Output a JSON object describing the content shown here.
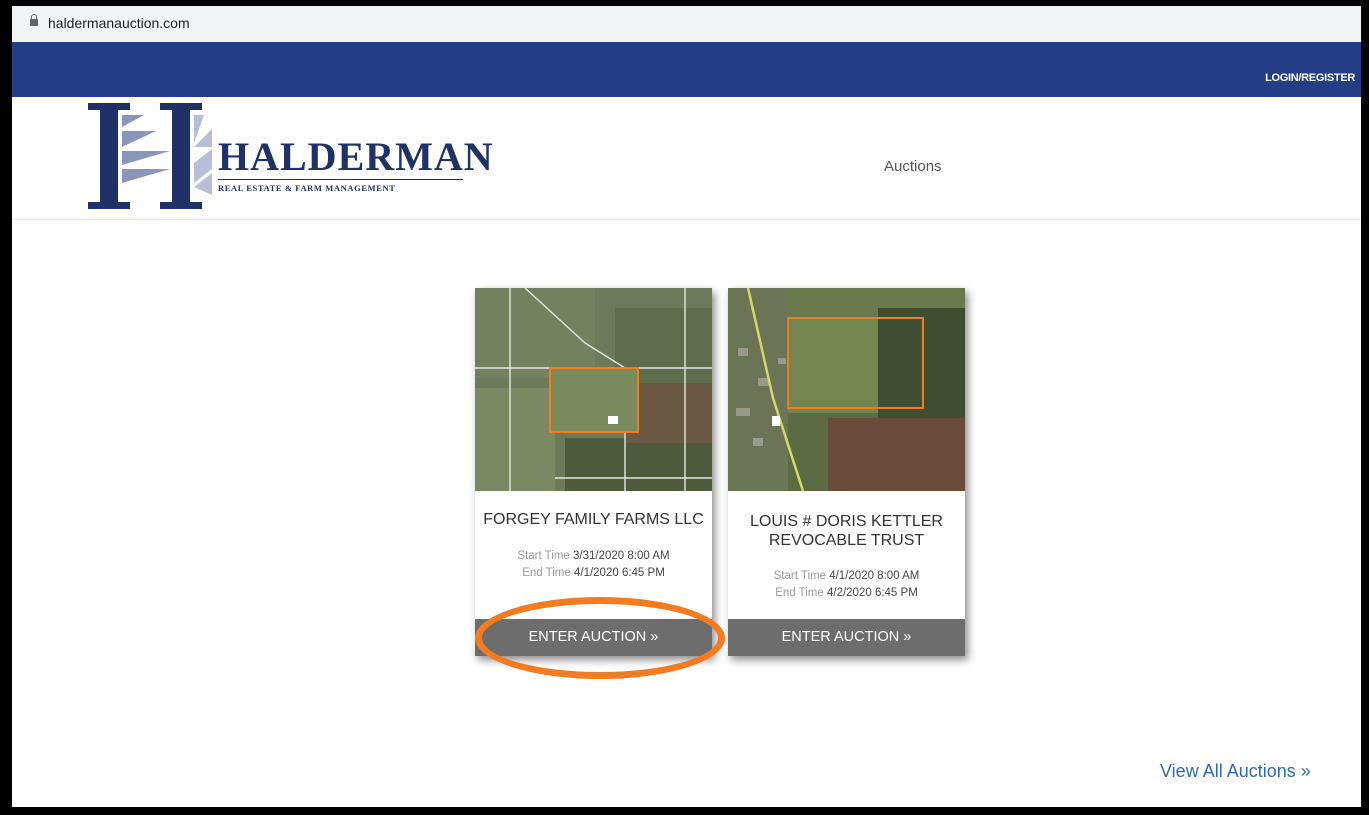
{
  "browser": {
    "url": "haldermanauction.com"
  },
  "topnav": {
    "login_label": "LOGIN/REGISTER"
  },
  "header": {
    "brand_name": "HALDERMAN",
    "brand_tagline": "REAL ESTATE & FARM MANAGEMENT",
    "nav_auctions": "Auctions"
  },
  "auctions": [
    {
      "title": "FORGEY FAMILY FARMS LLC",
      "start_label": "Start Time",
      "start_value": "3/31/2020 8:00 AM",
      "end_label": "End Time",
      "end_value": "4/1/2020 6:45 PM",
      "button_label": "ENTER AUCTION »"
    },
    {
      "title_line1": "LOUIS # DORIS KETTLER",
      "title_line2": "REVOCABLE TRUST",
      "start_label": "Start Time",
      "start_value": "4/1/2020 8:00 AM",
      "end_label": "End Time",
      "end_value": "4/2/2020 6:45 PM",
      "button_label": "ENTER AUCTION »"
    }
  ],
  "footer": {
    "view_all_label": "View All Auctions »"
  },
  "colors": {
    "nav_bar": "#233e85",
    "brand": "#1f3167",
    "button": "#6d6d6d",
    "highlight": "#f47b20",
    "link": "#2f6ab0"
  }
}
